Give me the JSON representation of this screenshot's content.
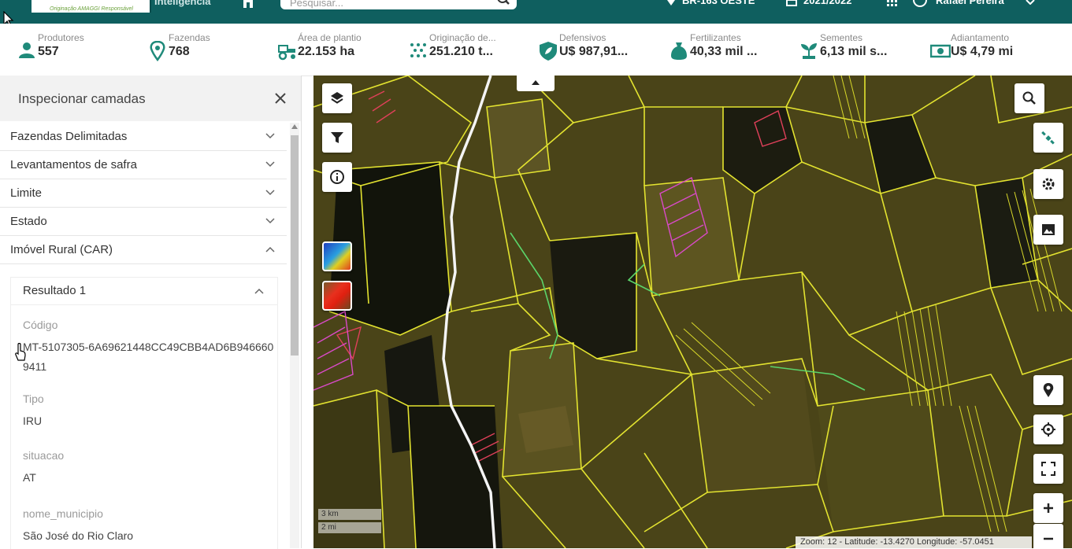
{
  "topbar": {
    "logo_subtitle": "Originação AMAGGI Responsável",
    "brand": "Inteligência",
    "search_placeholder": "Pesquisar...",
    "location": "BR-163 OESTE",
    "season": "2021/2022",
    "user": "Rafael Pereira"
  },
  "kpis": [
    {
      "label": "Produtores",
      "value": "557",
      "icon": "person-icon"
    },
    {
      "label": "Fazendas",
      "value": "768",
      "icon": "map-pin-icon"
    },
    {
      "label": "Área de plantio",
      "value": "22.153 ha",
      "icon": "tractor-icon"
    },
    {
      "label": "Originação de...",
      "value": "251.210 t...",
      "icon": "grain-icon"
    },
    {
      "label": "Defensivos",
      "value": "U$ 987,91...",
      "icon": "shield-icon"
    },
    {
      "label": "Fertilizantes",
      "value": "40,33 mil ...",
      "icon": "sack-icon"
    },
    {
      "label": "Sementes",
      "value": "6,13 mil s...",
      "icon": "sprout-icon"
    },
    {
      "label": "Adiantamento",
      "value": "U$ 4,79 mi",
      "icon": "money-icon"
    }
  ],
  "panel": {
    "title": "Inspecionar camadas",
    "layers": [
      "Fazendas Delimitadas",
      "Levantamentos de safra",
      "Limite",
      "Estado",
      "Imóvel Rural (CAR)"
    ],
    "result": {
      "title": "Resultado 1",
      "fields": [
        {
          "label": "Código",
          "value": "MT-5107305-6A69621448CC49CBB4AD6B9466609411"
        },
        {
          "label": "Tipo",
          "value": "IRU"
        },
        {
          "label": "situacao",
          "value": "AT"
        },
        {
          "label": "nome_municipio",
          "value": "São José do Rio Claro"
        }
      ]
    }
  },
  "map": {
    "scale_km": "3 km",
    "scale_mi": "2 mi",
    "coords": "Zoom: 12 - Latitude: -13.4270 Longitude: -57.0451"
  },
  "colors": {
    "topbar": "#0f5f5f",
    "accent": "#1f8a7a",
    "parcel": "#e3e330"
  }
}
